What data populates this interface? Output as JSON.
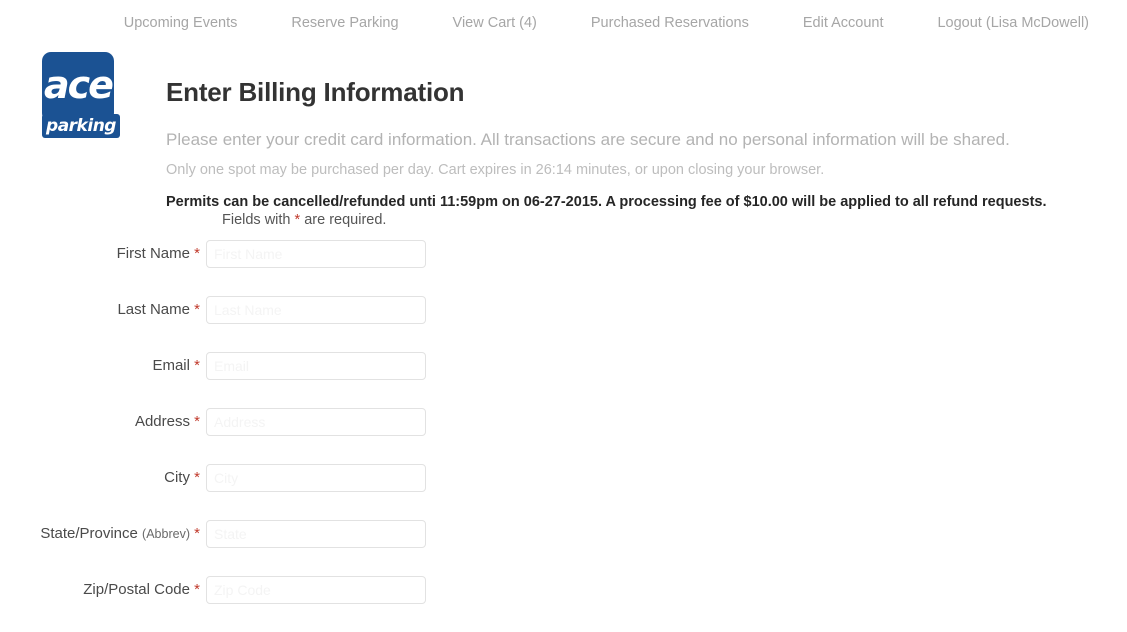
{
  "nav": {
    "items": [
      {
        "label": "Upcoming Events",
        "name": "nav-upcoming-events"
      },
      {
        "label": "Reserve Parking",
        "name": "nav-reserve-parking"
      },
      {
        "label": "View Cart (4)",
        "name": "nav-view-cart"
      },
      {
        "label": "Purchased Reservations",
        "name": "nav-purchased-reservations"
      },
      {
        "label": "Edit Account",
        "name": "nav-edit-account"
      },
      {
        "label": "Logout (Lisa McDowell)",
        "name": "nav-logout"
      }
    ]
  },
  "logo": {
    "mark": "ace",
    "word": "parking",
    "color": "#1b5293"
  },
  "page": {
    "title": "Enter Billing Information",
    "lead": "Please enter your credit card information. All transactions are secure and no personal information will be shared.",
    "subnote": "Only one spot may be purchased per day. Cart expires in 26:14 minutes, or upon closing your browser.",
    "refund_note": "Permits can be cancelled/refunded unti 11:59pm on 06-27-2015. A processing fee of $10.00 will be applied to all refund requests.",
    "required_note_before": "Fields with ",
    "required_marker": "*",
    "required_note_after": " are required."
  },
  "form": {
    "fields": [
      {
        "label": "First Name",
        "sub": "",
        "required": "*",
        "value": "",
        "placeholder": "First Name"
      },
      {
        "label": "Last Name",
        "sub": "",
        "required": "*",
        "value": "",
        "placeholder": "Last Name"
      },
      {
        "label": "Email",
        "sub": "",
        "required": "*",
        "value": "",
        "placeholder": "Email"
      },
      {
        "label": "Address",
        "sub": "",
        "required": "*",
        "value": "",
        "placeholder": "Address"
      },
      {
        "label": "City",
        "sub": "",
        "required": "*",
        "value": "",
        "placeholder": "City"
      },
      {
        "label": "State/Province",
        "sub": "(Abbrev)",
        "required": "*",
        "value": "",
        "placeholder": "State"
      },
      {
        "label": "Zip/Postal Code",
        "sub": "",
        "required": "*",
        "value": "",
        "placeholder": "Zip Code"
      }
    ]
  },
  "colors": {
    "brand_blue": "#1b5293",
    "required_red": "#c0392b",
    "muted_text": "#b3b3b3",
    "border": "#e2e2e2"
  }
}
